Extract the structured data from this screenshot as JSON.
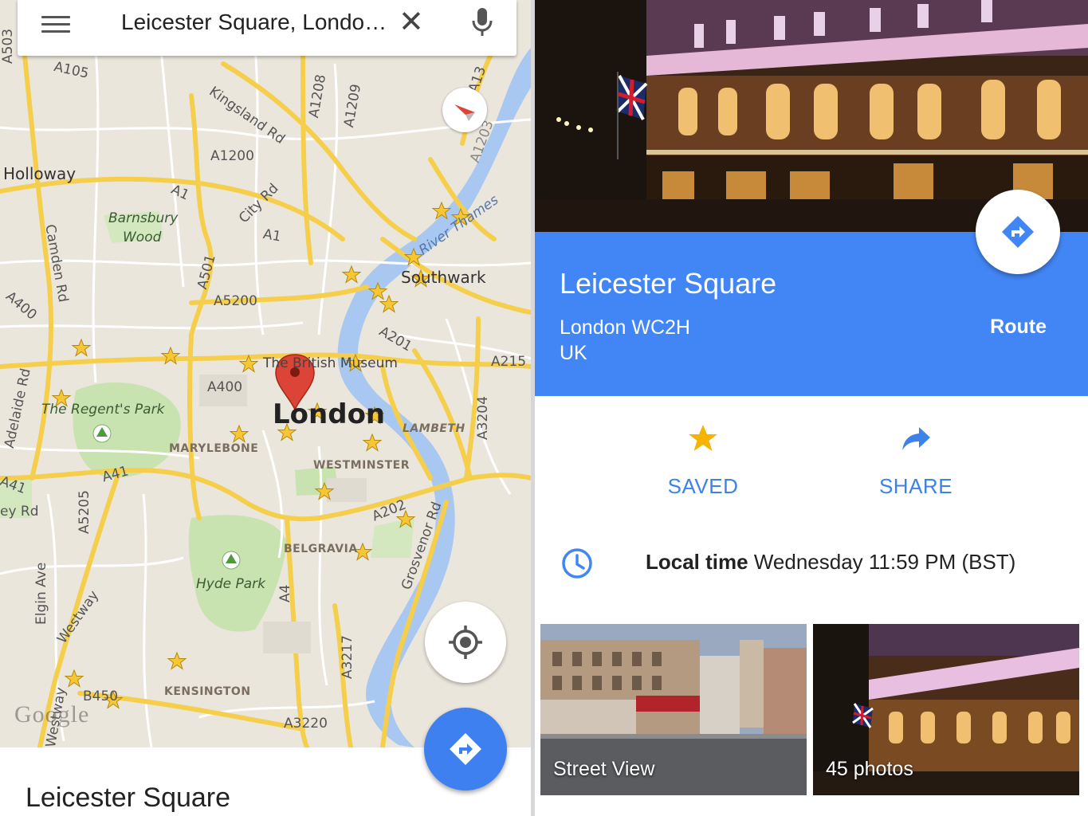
{
  "search": {
    "query": "Leicester Square, Londo…"
  },
  "map": {
    "labels": {
      "holloway": "Holloway",
      "kingsland": "Kingsland Rd",
      "city_rd": "City Rd",
      "barnsbury1": "Barnsbury",
      "barnsbury2": "Wood",
      "camden_rd": "Camden Rd",
      "southwark": "Southwark",
      "river": "River Thames",
      "regents_park": "The Regent's Park",
      "british_museum": "The British Museum",
      "london": "London",
      "lambeth": "LAMBETH",
      "marylebone": "MARYLEBONE",
      "westminster": "WESTMINSTER",
      "belgravia": "BELGRAVIA",
      "hyde_park": "Hyde Park",
      "kensington": "KENSINGTON",
      "grosvenor": "Grosvenor Rd",
      "elgin": "Elgin Ave",
      "westway": "Westway",
      "westway2": "Westway",
      "a105": "A105",
      "a1208": "A1208",
      "a1209": "A1209",
      "a1200": "A1200",
      "a1": "A1",
      "a1b": "A1",
      "a13": "A13",
      "a1203": "A1203",
      "a501": "A501",
      "a5200": "A5200",
      "a400": "A400",
      "a400b": "A400",
      "a201": "A201",
      "a215": "A215",
      "a3204": "A3204",
      "a41": "A41",
      "a41b": "A41",
      "a5205": "A5205",
      "a202": "A202",
      "a4": "A4",
      "a3217": "A3217",
      "a3220": "A3220",
      "b450": "B450",
      "ey_rd": "ey Rd",
      "adelaide": "Adelaide Rd",
      "a503": "A503"
    },
    "google_logo": "Google"
  },
  "bottom_sheet": {
    "title": "Leicester Square"
  },
  "place": {
    "title": "Leicester Square",
    "address_line1": "London WC2H",
    "address_line2": "UK",
    "route_label": "Route"
  },
  "actions": {
    "saved": "SAVED",
    "share": "SHARE"
  },
  "local_time": {
    "label": "Local time",
    "value": "Wednesday 11:59 PM (BST)"
  },
  "thumbnails": {
    "street_view": "Street View",
    "photos": "45 photos"
  },
  "colors": {
    "accent": "#4285f4",
    "fab": "#3f80f0",
    "saved_star": "#f4b400"
  }
}
